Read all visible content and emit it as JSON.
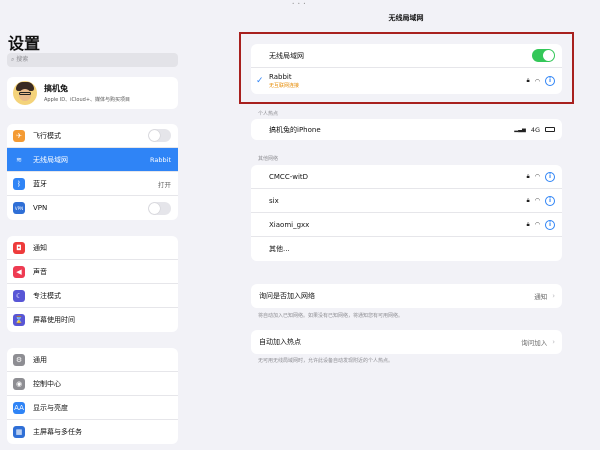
{
  "topbar": {
    "dots": "• • •"
  },
  "sidebar": {
    "title": "设置",
    "search_placeholder": "搜索",
    "profile": {
      "name": "搞机兔",
      "subtitle": "Apple ID、iCloud+、媒体与购买项目"
    },
    "group1": [
      {
        "label": "飞行模式",
        "icon": "airplane-icon",
        "color": "#f49b34",
        "type": "toggle",
        "glyph": "✈"
      },
      {
        "label": "无线局域网",
        "icon": "wifi-icon",
        "color": "#2f84f6",
        "value": "Rabbit",
        "active": true,
        "glyph": "≋"
      },
      {
        "label": "蓝牙",
        "icon": "bluetooth-icon",
        "color": "#2f84f6",
        "value": "打开",
        "glyph": "ᛒ"
      },
      {
        "label": "VPN",
        "icon": "vpn-icon",
        "color": "#2f6fd6",
        "type": "toggle",
        "glyph": "VPN"
      }
    ],
    "group2": [
      {
        "label": "通知",
        "icon": "notification-icon",
        "color": "#ee3b3b",
        "glyph": "◘"
      },
      {
        "label": "声音",
        "icon": "sound-icon",
        "color": "#ee3b52",
        "glyph": "◀"
      },
      {
        "label": "专注模式",
        "icon": "moon-icon",
        "color": "#5856d6",
        "glyph": "☾"
      },
      {
        "label": "屏幕使用时间",
        "icon": "hourglass-icon",
        "color": "#5856d6",
        "glyph": "⌛"
      }
    ],
    "group3": [
      {
        "label": "通用",
        "icon": "gear-icon",
        "color": "#8e8e93",
        "glyph": "⚙"
      },
      {
        "label": "控制中心",
        "icon": "control-center-icon",
        "color": "#8e8e93",
        "glyph": "◉"
      },
      {
        "label": "显示与亮度",
        "icon": "display-icon",
        "color": "#2f84f6",
        "glyph": "AA"
      },
      {
        "label": "主屏幕与多任务",
        "icon": "home-screen-icon",
        "color": "#2f6fd6",
        "glyph": "▦"
      }
    ]
  },
  "detail": {
    "title": "无线局域网",
    "wifi_toggle_label": "无线局域网",
    "current_network": {
      "name": "Rabbit",
      "status": "无互联网连接"
    },
    "personal_hotspot_label": "个人热点",
    "hotspot": {
      "name": "搞机兔的iPhone",
      "signal": "4G"
    },
    "other_networks_label": "其他网络",
    "networks": [
      "CMCC-witD",
      "six",
      "Xiaomi_gxx"
    ],
    "other_label": "其他...",
    "ask_join": {
      "label": "询问是否加入网络",
      "value": "通知"
    },
    "ask_join_note": "将自动加入已知网络。如果没有已知网络，将通知您有可用网络。",
    "auto_join": {
      "label": "自动加入热点",
      "value": "询问加入"
    },
    "auto_join_note": "无可用无线局域网时，允许此设备自动发现附近的个人热点。"
  }
}
